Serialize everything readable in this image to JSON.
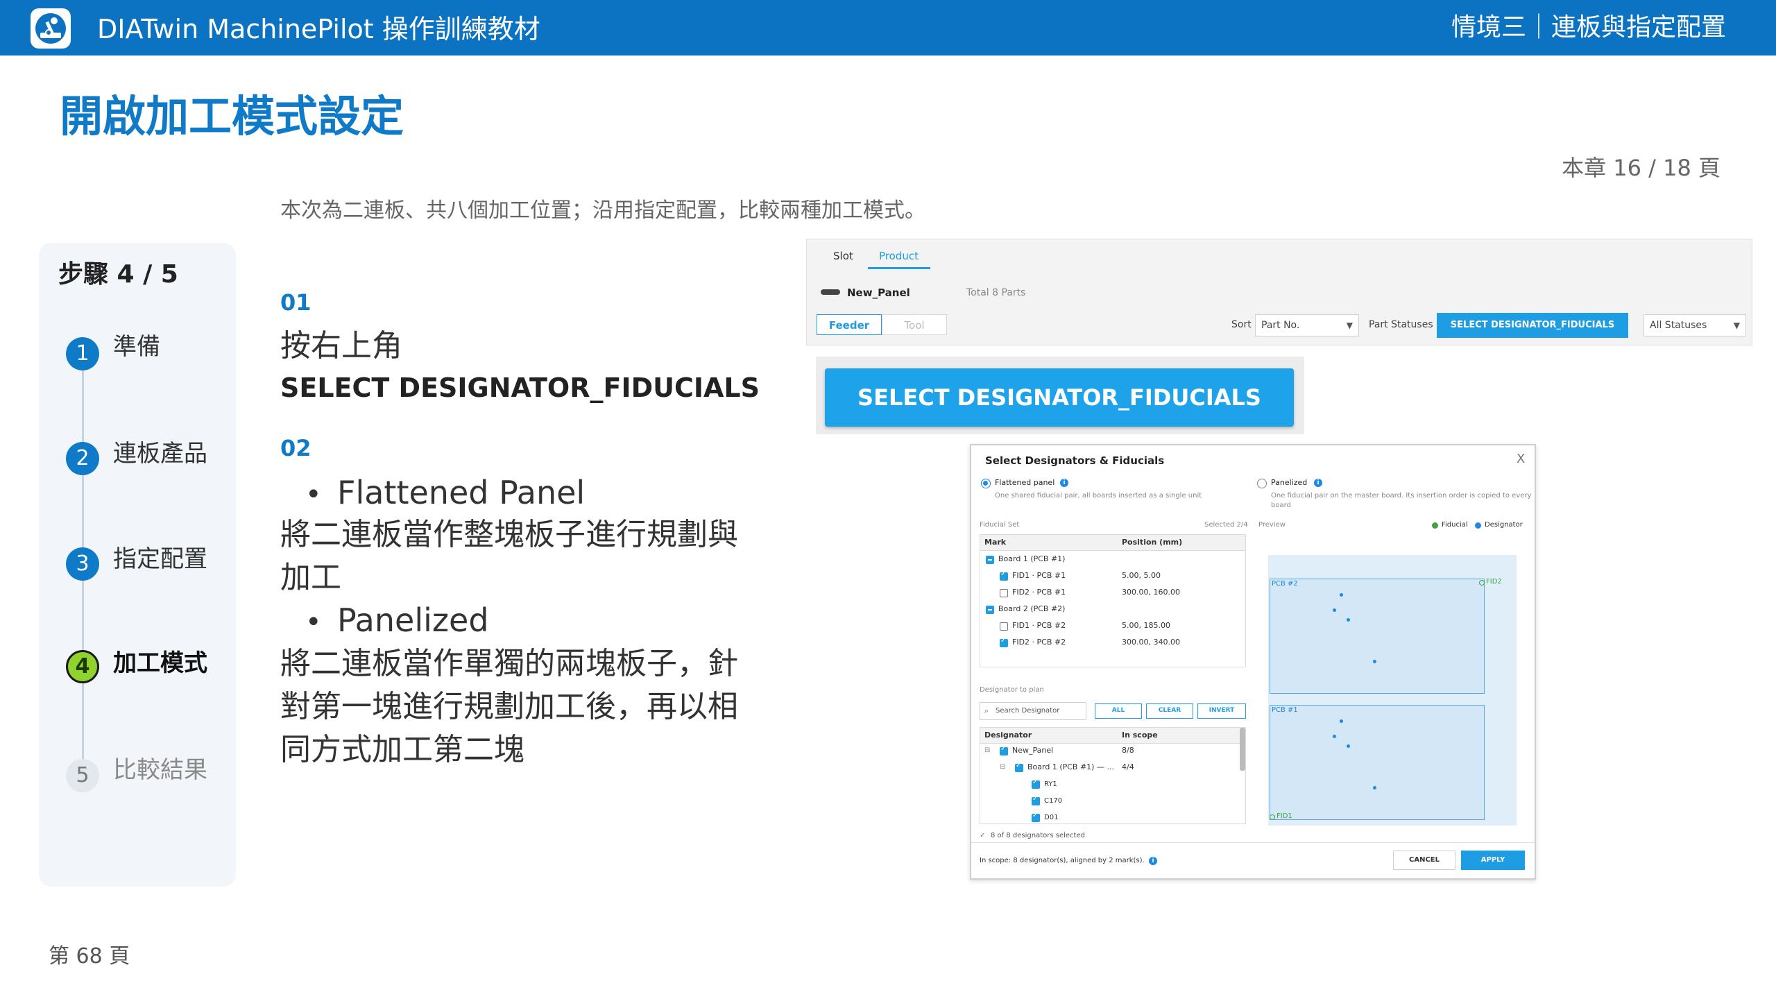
{
  "header": {
    "app_title": "DIATwin MachinePilot 操作訓練教材",
    "scenario": "情境三｜連板與指定配置",
    "logo_icon": "robot-arm-icon"
  },
  "page": {
    "title": "開啟加工模式設定",
    "chapter_counter": "本章 16 / 18 頁",
    "subtitle": "本次為二連板、共八個加工位置；沿用指定配置，比較兩種加工模式。",
    "footer_page": "第 68 頁"
  },
  "steps": {
    "header": "步驟 4 / 5",
    "items": [
      {
        "number": "1",
        "label": "準備",
        "state": "done"
      },
      {
        "number": "2",
        "label": "連板產品",
        "state": "done"
      },
      {
        "number": "3",
        "label": "指定配置",
        "state": "done"
      },
      {
        "number": "4",
        "label": "加工模式",
        "state": "active"
      },
      {
        "number": "5",
        "label": "比較結果",
        "state": "pending"
      }
    ],
    "colors": {
      "done": "#0f7ac8",
      "active": "#8fd32c",
      "pending": "#e3e8ee"
    }
  },
  "instructions": {
    "s1_num": "01",
    "s1_line1": "按右上角",
    "s1_line2": "SELECT DESIGNATOR_FIDUCIALS",
    "s2_num": "02",
    "bullet1": "Flattened  Panel",
    "bullet1_desc_1": "將二連板當作整塊板子進行規劃與",
    "bullet1_desc_2": "加工",
    "bullet2": "Panelized",
    "bullet2_desc_1": "將二連板當作單獨的兩塊板子，針",
    "bullet2_desc_2": "對第一塊進行規劃加工後，再以相",
    "bullet2_desc_3": "同方式加工第二塊"
  },
  "toolbar_shot": {
    "tab_slot": "Slot",
    "tab_product": "Product",
    "panel_name": "New_Panel",
    "total_parts": "Total 8 Parts",
    "feeder": "Feeder",
    "tool": "Tool",
    "sort_label": "Sort",
    "sort_value": "Part No.",
    "part_statuses_label": "Part Statuses",
    "select_button": "SELECT DESIGNATOR_FIDUCIALS",
    "status_value": "All Statuses",
    "accent": "#1e9de3"
  },
  "zoom_shot": {
    "button": "SELECT DESIGNATOR_FIDUCIALS"
  },
  "dialog": {
    "title": "Select Designators & Fiducials",
    "close": "X",
    "mode_flat": "Flattened panel",
    "mode_flat_desc": "One shared fiducial pair, all boards inserted as a single unit",
    "mode_panel": "Panelized",
    "mode_panel_desc_1": "One fiducial pair on the master board. Its insertion order is copied to every",
    "mode_panel_desc_2": "board",
    "fiducial_set": "Fiducial Set",
    "selected": "Selected 2/4",
    "preview_label": "Preview",
    "legend_fiducial": "Fiducial",
    "legend_designator": "Designator",
    "fid_table": {
      "col_mark": "Mark",
      "col_pos": "Position (mm)",
      "rows": [
        {
          "mark": "Board 1  (PCB #1)",
          "pos": "",
          "type": "group"
        },
        {
          "mark": "FID1 · PCB #1",
          "pos": "5.00, 5.00",
          "type": "on"
        },
        {
          "mark": "FID2 · PCB #1",
          "pos": "300.00, 160.00",
          "type": "off"
        },
        {
          "mark": "Board 2  (PCB #2)",
          "pos": "",
          "type": "group"
        },
        {
          "mark": "FID1 · PCB #2",
          "pos": "5.00, 185.00",
          "type": "off"
        },
        {
          "mark": "FID2 · PCB #2",
          "pos": "300.00, 340.00",
          "type": "on"
        }
      ]
    },
    "designator_to_plan": "Designator to plan",
    "search_placeholder": "Search Designator",
    "btn_all": "ALL",
    "btn_clear": "CLEAR",
    "btn_invert": "INVERT",
    "des_table": {
      "col_designator": "Designator",
      "col_scope": "In scope",
      "rows": [
        {
          "name": "New_Panel",
          "scope": "8/8"
        },
        {
          "name": "Board 1  (PCB #1)  — ...",
          "scope": "4/4"
        },
        {
          "name": "RY1",
          "scope": ""
        },
        {
          "name": "C170",
          "scope": ""
        },
        {
          "name": "D01",
          "scope": ""
        }
      ]
    },
    "selected_summary": "8 of 8 designators selected",
    "scope_summary": "In scope: 8 designator(s), aligned by 2 mark(s).",
    "pcb2": "PCB #2",
    "pcb1": "PCB #1",
    "fid2": "FID2",
    "fid1": "FID1",
    "cancel": "CANCEL",
    "apply": "APPLY"
  }
}
